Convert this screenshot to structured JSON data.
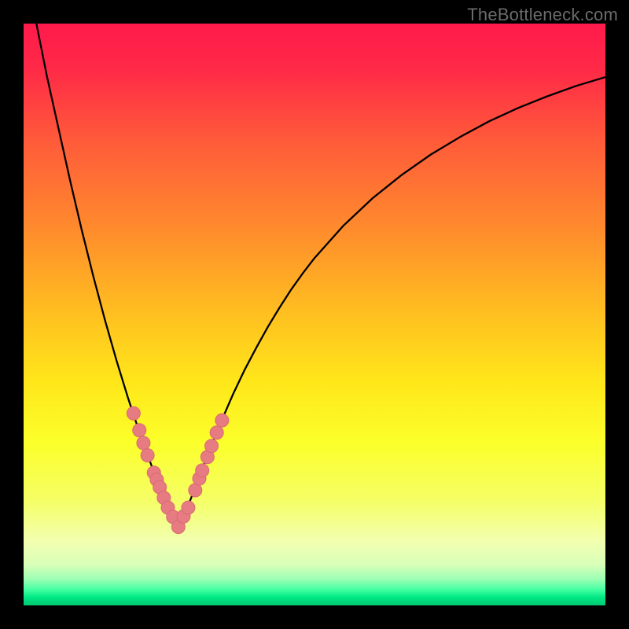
{
  "watermark": "TheBottleneck.com",
  "colors": {
    "frame": "#000000",
    "gradient_stops": [
      {
        "offset": 0.0,
        "color": "#ff1a4b"
      },
      {
        "offset": 0.08,
        "color": "#ff2a47"
      },
      {
        "offset": 0.2,
        "color": "#ff5a3a"
      },
      {
        "offset": 0.35,
        "color": "#ff8a2d"
      },
      {
        "offset": 0.5,
        "color": "#ffc020"
      },
      {
        "offset": 0.62,
        "color": "#ffe81a"
      },
      {
        "offset": 0.72,
        "color": "#fbff2a"
      },
      {
        "offset": 0.82,
        "color": "#f5ff66"
      },
      {
        "offset": 0.89,
        "color": "#f2ffb0"
      },
      {
        "offset": 0.93,
        "color": "#d8ffb8"
      },
      {
        "offset": 0.955,
        "color": "#9bffb4"
      },
      {
        "offset": 0.974,
        "color": "#3effa0"
      },
      {
        "offset": 0.986,
        "color": "#00e884"
      },
      {
        "offset": 1.0,
        "color": "#00c872"
      }
    ],
    "curve": "#000000",
    "marker_fill": "#e77b82",
    "marker_stroke": "#d96a72"
  },
  "chart_data": {
    "type": "line",
    "title": "",
    "xlabel": "",
    "ylabel": "",
    "xlim": [
      0,
      100
    ],
    "ylim": [
      0,
      100
    ],
    "grid": false,
    "x_min_point": 26.5,
    "series": [
      {
        "name": "bottleneck-curve",
        "x": [
          0,
          2,
          4,
          6,
          8,
          10,
          12,
          14,
          16,
          18,
          20,
          21,
          22,
          23,
          24,
          24.5,
          25,
          25.5,
          26,
          26.25,
          26.5,
          26.75,
          27,
          27.5,
          28,
          28.5,
          29,
          30,
          31,
          32,
          33,
          34,
          36,
          38,
          40,
          42,
          44,
          46,
          48,
          50,
          55,
          60,
          65,
          70,
          75,
          80,
          85,
          90,
          95,
          100
        ],
        "values": [
          112,
          101,
          91,
          82,
          73,
          64.5,
          56.5,
          49,
          42,
          35.5,
          29.5,
          26.7,
          24,
          21.4,
          18.9,
          17.7,
          16.5,
          15.3,
          14.2,
          13.7,
          13.3,
          13.7,
          14.2,
          15.3,
          16.5,
          17.7,
          19,
          21.6,
          24.2,
          26.8,
          29.3,
          31.7,
          36.3,
          40.5,
          44.3,
          47.9,
          51.2,
          54.3,
          57.1,
          59.7,
          65.3,
          70,
          74,
          77.5,
          80.5,
          83.2,
          85.5,
          87.5,
          89.3,
          90.8
        ]
      }
    ],
    "markers": {
      "name": "highlighted-points",
      "x": [
        18.9,
        19.9,
        20.6,
        21.3,
        22.4,
        22.9,
        23.4,
        24.1,
        24.8,
        25.7,
        26.6,
        27.5,
        28.3,
        29.5,
        30.2,
        30.7,
        31.6,
        32.3,
        33.2,
        34.1
      ],
      "values": [
        33.0,
        30.1,
        27.9,
        25.8,
        22.8,
        21.6,
        20.3,
        18.5,
        16.8,
        15.2,
        13.5,
        15.3,
        16.8,
        19.8,
        21.8,
        23.2,
        25.5,
        27.4,
        29.7,
        31.8
      ]
    }
  }
}
